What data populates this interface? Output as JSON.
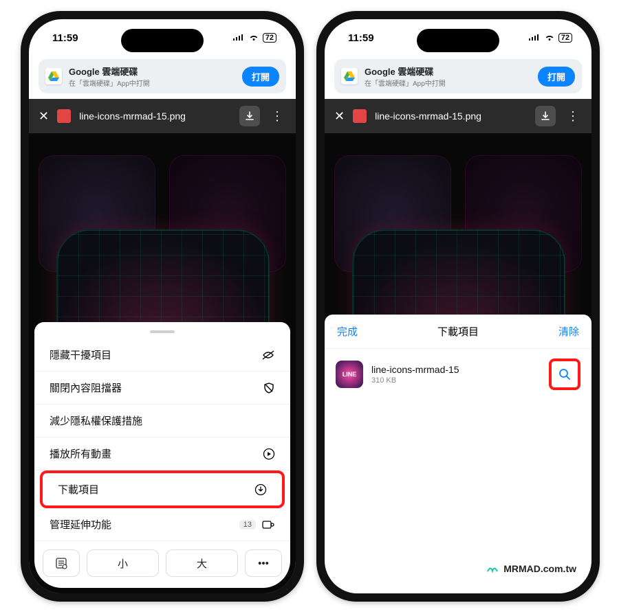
{
  "status": {
    "time": "11:59",
    "battery": "72"
  },
  "banner": {
    "title": "Google 雲端硬碟",
    "subtitle": "在「雲端硬碟」App中打開",
    "open_label": "打開"
  },
  "filebar": {
    "filename": "line-icons-mrmad-15.png"
  },
  "bg_label": "LINE",
  "menu": {
    "hide_distractions": "隱藏干擾項目",
    "disable_blockers": "關閉內容阻擋器",
    "reduce_privacy": "減少隱私權保護措施",
    "play_animations": "播放所有動畫",
    "downloads": "下載項目",
    "manage_extensions": "管理延伸功能",
    "ext_count": "13",
    "size_small": "小",
    "size_large": "大"
  },
  "downloads": {
    "done": "完成",
    "title": "下載項目",
    "clear": "清除",
    "item_name": "line-icons-mrmad-15",
    "item_size": "310 KB"
  },
  "watermark": "MRMAD.com.tw"
}
